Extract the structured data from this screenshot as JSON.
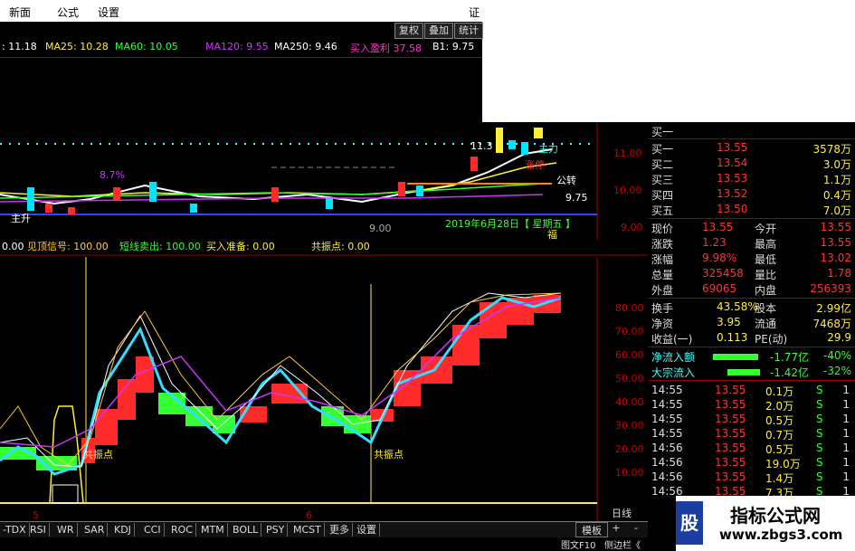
{
  "menu": {
    "items": [
      "新面",
      "公式",
      "设置"
    ],
    "right_fragment": "证"
  },
  "toolbar": {
    "fuquan": "复权",
    "diejia": "叠加",
    "tongji": "统计"
  },
  "ma": {
    "ma_a": ": 11.18",
    "ma25": "MA25: 10.28",
    "ma60": "MA60: 10.05",
    "ma120": "MA120: 9.55",
    "ma250": "MA250: 9.46",
    "buy_profit": "买入盈利 37.58",
    "b1": "B1: 9.75"
  },
  "main_chart": {
    "price_labels": [
      "11.00",
      "10.00",
      "9.00"
    ],
    "annotations": {
      "pct": "8.7%",
      "high": "11.3",
      "price_line": "9.00",
      "right_line": "9.75",
      "date": "2019年6月28日【 星期五 】",
      "shengjin": "主升",
      "zhang": "涨停",
      "zhuli": "主力",
      "fu": "福",
      "gong": "公转"
    },
    "colors": {
      "up": "#ff2a2a",
      "down": "#00e5ff",
      "ma_white": "#ffffff",
      "ma_yellow": "#ffee33",
      "ma_green": "#33ff33",
      "ma_purple": "#cc33ff"
    }
  },
  "signals": {
    "a": "0.00",
    "b": "见顶信号: 100.00",
    "c": "短线卖出: 100.00",
    "d": "买入准备: 0.00",
    "e": "共振点: 0.00"
  },
  "indicator": {
    "y_labels": [
      "80.00",
      "70.00",
      "60.00",
      "50.00",
      "40.00",
      "30.00",
      "20.00",
      "10.00"
    ],
    "annot": "共振点",
    "period": "日线",
    "x_ticks": [
      "5",
      "6"
    ]
  },
  "panel": {
    "buy_header": "买一",
    "bids": [
      {
        "label": "买一",
        "price": "13.55",
        "vol": "3578万"
      },
      {
        "label": "买二",
        "price": "13.54",
        "vol": "3.0万"
      },
      {
        "label": "买三",
        "price": "13.53",
        "vol": "1.1万"
      },
      {
        "label": "买四",
        "price": "13.52",
        "vol": "0.4万"
      },
      {
        "label": "买五",
        "price": "13.50",
        "vol": "7.0万"
      }
    ],
    "quotes": [
      {
        "l1": "现价",
        "v1": "13.55",
        "l2": "今开",
        "v2": "13.55"
      },
      {
        "l1": "涨跌",
        "v1": "1.23",
        "l2": "最高",
        "v2": "13.55"
      },
      {
        "l1": "涨幅",
        "v1": "9.98%",
        "l2": "最低",
        "v2": "13.02"
      },
      {
        "l1": "总量",
        "v1": "325458",
        "l2": "量比",
        "v2": "1.78"
      },
      {
        "l1": "外盘",
        "v1": "69065",
        "l2": "内盘",
        "v2": "256393"
      }
    ],
    "fund": [
      {
        "l1": "换手",
        "v1": "43.58%",
        "l2": "股本",
        "v2": "2.99亿"
      },
      {
        "l1": "净资",
        "v1": "3.95",
        "l2": "流通",
        "v2": "7468万"
      },
      {
        "l1": "收益(一)",
        "v1": "0.113",
        "l2": "PE(动)",
        "v2": "29.9"
      }
    ],
    "flows": [
      {
        "label": "净流入额",
        "value": "-1.77亿",
        "pct": "-40%"
      },
      {
        "label": "大宗流入",
        "value": "-1.42亿",
        "pct": "-32%"
      }
    ],
    "ticks": [
      {
        "t": "14:55",
        "p": "13.55",
        "v": "0.1万",
        "s": "S",
        "n": "1"
      },
      {
        "t": "14:55",
        "p": "13.55",
        "v": "2.0万",
        "s": "S",
        "n": "1"
      },
      {
        "t": "14:55",
        "p": "13.55",
        "v": "0.5万",
        "s": "S",
        "n": "1"
      },
      {
        "t": "14:55",
        "p": "13.55",
        "v": "0.7万",
        "s": "S",
        "n": "1"
      },
      {
        "t": "14:56",
        "p": "13.55",
        "v": "0.5万",
        "s": "S",
        "n": "1"
      },
      {
        "t": "14:56",
        "p": "13.55",
        "v": "19.0万",
        "s": "S",
        "n": "1"
      },
      {
        "t": "14:56",
        "p": "13.55",
        "v": "1.4万",
        "s": "S",
        "n": "1"
      },
      {
        "t": "14:56",
        "p": "13.55",
        "v": "7.3万",
        "s": "S",
        "n": "1"
      }
    ]
  },
  "tabs": [
    "-TDX",
    "RSI",
    "WR",
    "SAR",
    "KDJ",
    "CCI",
    "ROC",
    "MTM",
    "BOLL",
    "PSY",
    "MCST",
    "更多",
    "设置"
  ],
  "bottom_right": {
    "moban": "模板",
    "plus": "+",
    "minus": "-",
    "f10": "图文F10",
    "side": "侧边栏《"
  },
  "watermark": {
    "title": "指标公式网",
    "url": "www.zbgs3.com",
    "logo": "股"
  }
}
